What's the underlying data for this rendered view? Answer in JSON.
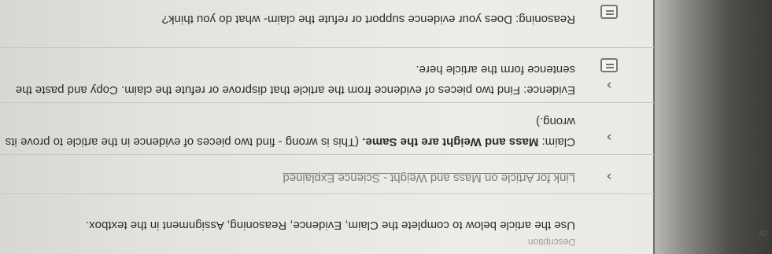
{
  "assignment": {
    "section_label": "Description",
    "instructions": "Use the article below to complete the Claim, Evidence, Reasoning, Assignment in the textbox.",
    "link_text": "Link for Article on Mass and Weight - Science Explained",
    "claim": {
      "label": "Claim:",
      "text_bold": "Mass and Weight are the Same.",
      "text_rest": " (This is wrong - find two pieces of evidence in the article to prove its",
      "text_wrap": "wrong.)"
    },
    "evidence": {
      "line1": "Evidence: Find two pieces of evidence from the article that disprove or refute the claim. Copy and paste the",
      "line2": "sentence form the article here."
    },
    "reasoning": {
      "line1": "Reasoning: Does your evidence support or refute the claim- what do you think?"
    },
    "edge_text": "or"
  },
  "icons": [
    "chevron-right-icon",
    "chevron-right-icon",
    "chevron-right-icon",
    "textbox-icon",
    "textbox-icon"
  ]
}
